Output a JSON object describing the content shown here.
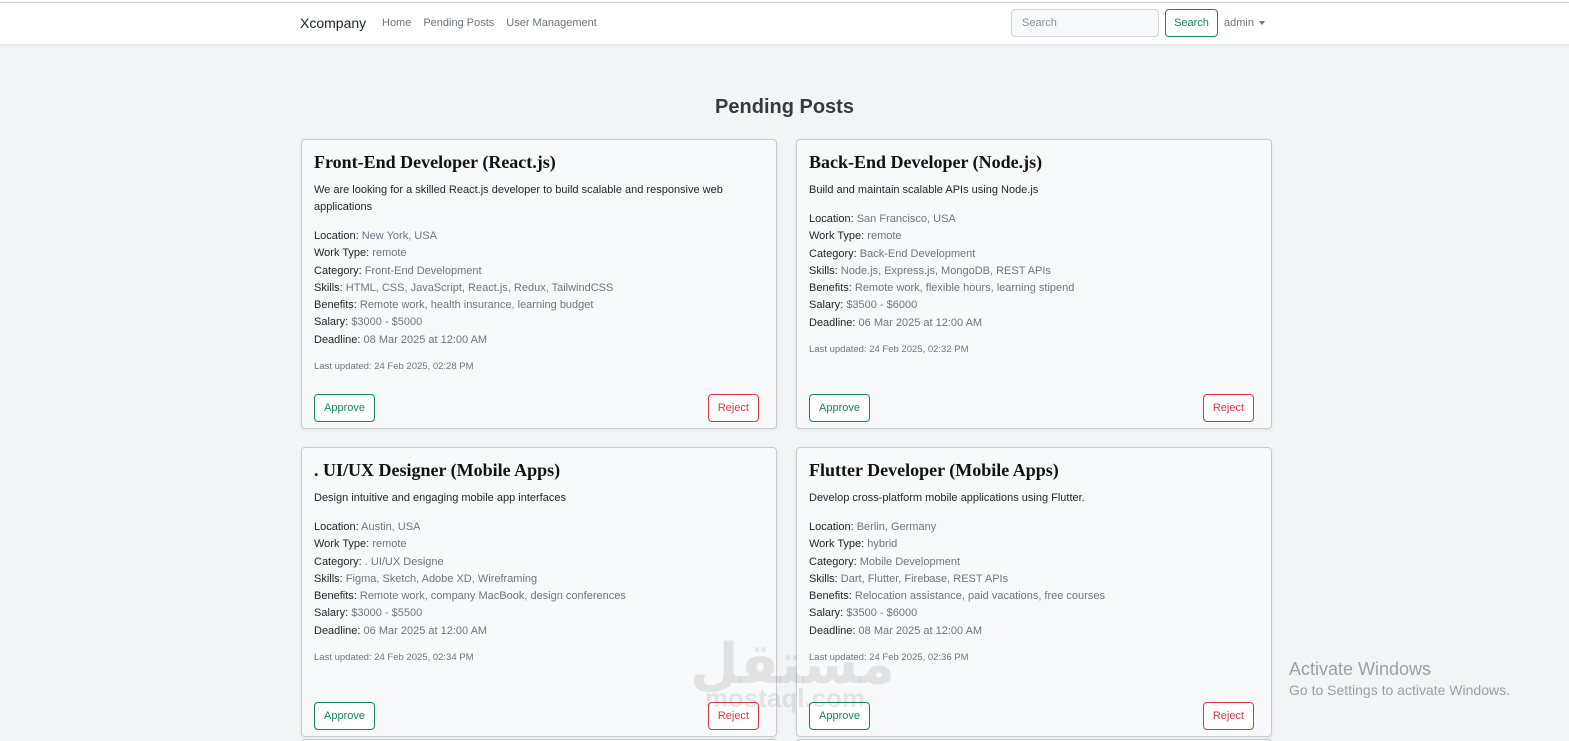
{
  "nav": {
    "brand": "Xcompany",
    "links": [
      "Home",
      "Pending Posts",
      "User Management"
    ],
    "search_placeholder": "Search",
    "search_button": "Search",
    "user": "admin"
  },
  "page_title": "Pending Posts",
  "labels": {
    "location": "Location:",
    "work_type": "Work Type:",
    "category": "Category:",
    "skills": "Skills:",
    "benefits": "Benefits:",
    "salary": "Salary:",
    "deadline": "Deadline:",
    "approve": "Approve",
    "reject": "Reject"
  },
  "posts": [
    {
      "title": "Front-End Developer (React.js)",
      "description": "We are looking for a skilled React.js developer to build scalable and responsive web applications",
      "location": "New York, USA",
      "work_type": "remote",
      "category": "Front-End Development",
      "skills": "HTML, CSS, JavaScript, React.js, Redux, TailwindCSS",
      "benefits": "Remote work, health insurance, learning budget",
      "salary": "$3000 - $5000",
      "deadline": "08 Mar 2025 at 12:00 AM",
      "updated": "Last updated: 24 Feb 2025, 02:28 PM"
    },
    {
      "title": "Back-End Developer (Node.js)",
      "description": "Build and maintain scalable APIs using Node.js",
      "location": "San Francisco, USA",
      "work_type": "remote",
      "category": "Back-End Development",
      "skills": "Node.js, Express.js, MongoDB, REST APIs",
      "benefits": "Remote work, flexible hours, learning stipend",
      "salary": "$3500 - $6000",
      "deadline": "06 Mar 2025 at 12:00 AM",
      "updated": "Last updated: 24 Feb 2025, 02:32 PM"
    },
    {
      "title": ". UI/UX Designer (Mobile Apps)",
      "description": "Design intuitive and engaging mobile app interfaces",
      "location": "Austin, USA",
      "work_type": "remote",
      "category": ". UI/UX Designe",
      "skills": "Figma, Sketch, Adobe XD, Wireframing",
      "benefits": "Remote work, company MacBook, design conferences",
      "salary": "$3000 - $5500",
      "deadline": "06 Mar 2025 at 12:00 AM",
      "updated": "Last updated: 24 Feb 2025, 02:34 PM"
    },
    {
      "title": "Flutter Developer (Mobile Apps)",
      "description": "Develop cross-platform mobile applications using Flutter.",
      "location": "Berlin, Germany",
      "work_type": "hybrid",
      "category": "Mobile Development",
      "skills": "Dart, Flutter, Firebase, REST APIs",
      "benefits": "Relocation assistance, paid vacations, free courses",
      "salary": "$3500 - $6000",
      "deadline": "08 Mar 2025 at 12:00 AM",
      "updated": "Last updated: 24 Feb 2025, 02:36 PM"
    }
  ],
  "os_watermark": {
    "title": "Activate Windows",
    "subtitle": "Go to Settings to activate Windows."
  },
  "site_watermark": {
    "arabic": "مستقل",
    "latin": "mostaql.com"
  }
}
